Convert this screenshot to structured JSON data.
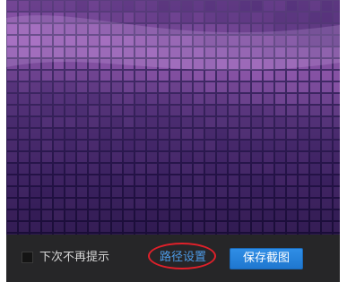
{
  "preview": {
    "image": "purple-mosaic-wallpaper"
  },
  "footer": {
    "dont_show_again_label": "下次不再提示",
    "dont_show_again_checked": false,
    "path_settings_label": "路径设置",
    "save_screenshot_label": "保存截图"
  },
  "colors": {
    "link": "#4d9be6",
    "button": "#1f77d0",
    "annotation": "#e0202a"
  }
}
